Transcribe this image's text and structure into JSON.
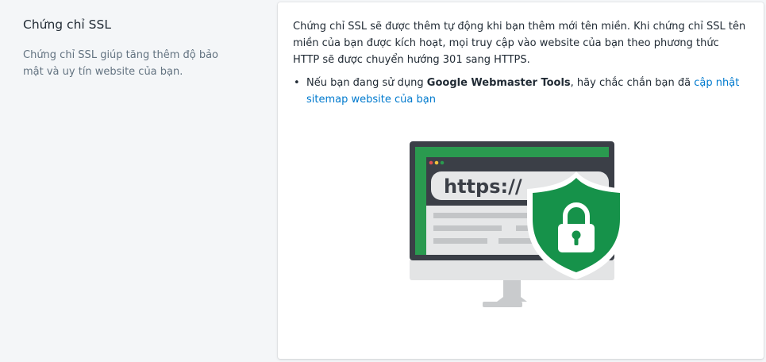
{
  "section": {
    "title": "Chứng chỉ SSL",
    "description": "Chứng chỉ SSL giúp tăng thêm độ bảo mật và uy tín website của bạn."
  },
  "card": {
    "intro": "Chứng chỉ SSL sẽ được thêm tự động khi bạn thêm mới tên miền. Khi chứng chỉ SSL tên miền của bạn được kích hoạt, mọi truy cập vào website của bạn theo phương thức HTTP sẽ được chuyển hướng 301 sang HTTPS.",
    "bullet": {
      "prefix": "Nếu bạn đang sử dụng ",
      "bold": "Google Webmaster Tools",
      "middle": ", hãy chắc chắn bạn đã ",
      "link": "cập nhật sitemap website của bạn"
    }
  },
  "illustration": {
    "url_text": "https://",
    "icon": "ssl-shield-lock-icon",
    "colors": {
      "green": "#2a9a4f",
      "shield": "#16924a",
      "monitor_frame": "#3b3f47",
      "stand": "#c9cbcd"
    }
  }
}
